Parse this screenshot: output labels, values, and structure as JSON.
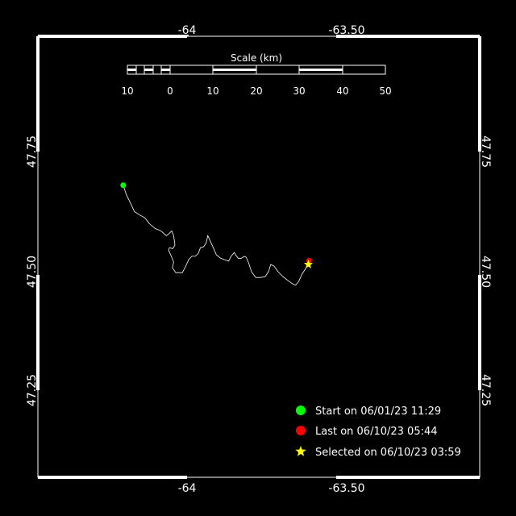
{
  "map": {
    "longitude_ticks": [
      "-64",
      "-63.50"
    ],
    "latitude_ticks": [
      "47.75",
      "47.50",
      "47.25"
    ],
    "extent": {
      "lon": [
        -64.5,
        -63.4
      ],
      "lat": [
        47.1,
        48.0
      ]
    },
    "colors": {
      "background": "#000000",
      "frame": "#ffffff",
      "track": "#ffffff",
      "start": "#00ff00",
      "last": "#ff0000",
      "selected": "#ffff00"
    }
  },
  "scale_bar": {
    "title": "Scale (km)",
    "labels": [
      "10",
      "0",
      "10",
      "20",
      "30",
      "40",
      "50"
    ]
  },
  "track": {
    "points": [
      [
        -64.2,
        47.68
      ],
      [
        -64.19,
        47.66
      ],
      [
        -64.175,
        47.64
      ],
      [
        -64.165,
        47.625
      ],
      [
        -64.148,
        47.618
      ],
      [
        -64.132,
        47.612
      ],
      [
        -64.118,
        47.6
      ],
      [
        -64.1,
        47.59
      ],
      [
        -64.082,
        47.585
      ],
      [
        -64.065,
        47.575
      ],
      [
        -64.055,
        47.58
      ],
      [
        -64.048,
        47.585
      ],
      [
        -64.042,
        47.575
      ],
      [
        -64.038,
        47.555
      ],
      [
        -64.045,
        47.548
      ],
      [
        -64.055,
        47.55
      ],
      [
        -64.058,
        47.545
      ],
      [
        -64.048,
        47.53
      ],
      [
        -64.042,
        47.52
      ],
      [
        -64.046,
        47.508
      ],
      [
        -64.035,
        47.498
      ],
      [
        -64.015,
        47.498
      ],
      [
        -64.005,
        47.51
      ],
      [
        -63.995,
        47.525
      ],
      [
        -63.985,
        47.532
      ],
      [
        -63.975,
        47.532
      ],
      [
        -63.965,
        47.538
      ],
      [
        -63.958,
        47.55
      ],
      [
        -63.948,
        47.552
      ],
      [
        -63.94,
        47.56
      ],
      [
        -63.935,
        47.575
      ],
      [
        -63.928,
        47.565
      ],
      [
        -63.918,
        47.55
      ],
      [
        -63.908,
        47.535
      ],
      [
        -63.895,
        47.528
      ],
      [
        -63.882,
        47.525
      ],
      [
        -63.87,
        47.522
      ],
      [
        -63.862,
        47.532
      ],
      [
        -63.852,
        47.54
      ],
      [
        -63.848,
        47.535
      ],
      [
        -63.84,
        47.528
      ],
      [
        -63.83,
        47.528
      ],
      [
        -63.82,
        47.532
      ],
      [
        -63.815,
        47.53
      ],
      [
        -63.808,
        47.52
      ],
      [
        -63.798,
        47.5
      ],
      [
        -63.785,
        47.488
      ],
      [
        -63.77,
        47.488
      ],
      [
        -63.755,
        47.49
      ],
      [
        -63.745,
        47.5
      ],
      [
        -63.738,
        47.515
      ],
      [
        -63.728,
        47.512
      ],
      [
        -63.715,
        47.5
      ],
      [
        -63.7,
        47.49
      ],
      [
        -63.685,
        47.482
      ],
      [
        -63.67,
        47.475
      ],
      [
        -63.66,
        47.472
      ],
      [
        -63.65,
        47.48
      ],
      [
        -63.64,
        47.495
      ],
      [
        -63.63,
        47.505
      ],
      [
        -63.62,
        47.515
      ]
    ]
  },
  "markers": {
    "start": [
      -64.2,
      47.68
    ],
    "last": [
      -63.618,
      47.523
    ],
    "selected": [
      -63.62,
      47.515
    ]
  },
  "legend": {
    "start_label": "Start on 06/01/23 11:29",
    "last_label": "Last on 06/10/23 05:44",
    "selected_label": "Selected on 06/10/23 03:59"
  }
}
